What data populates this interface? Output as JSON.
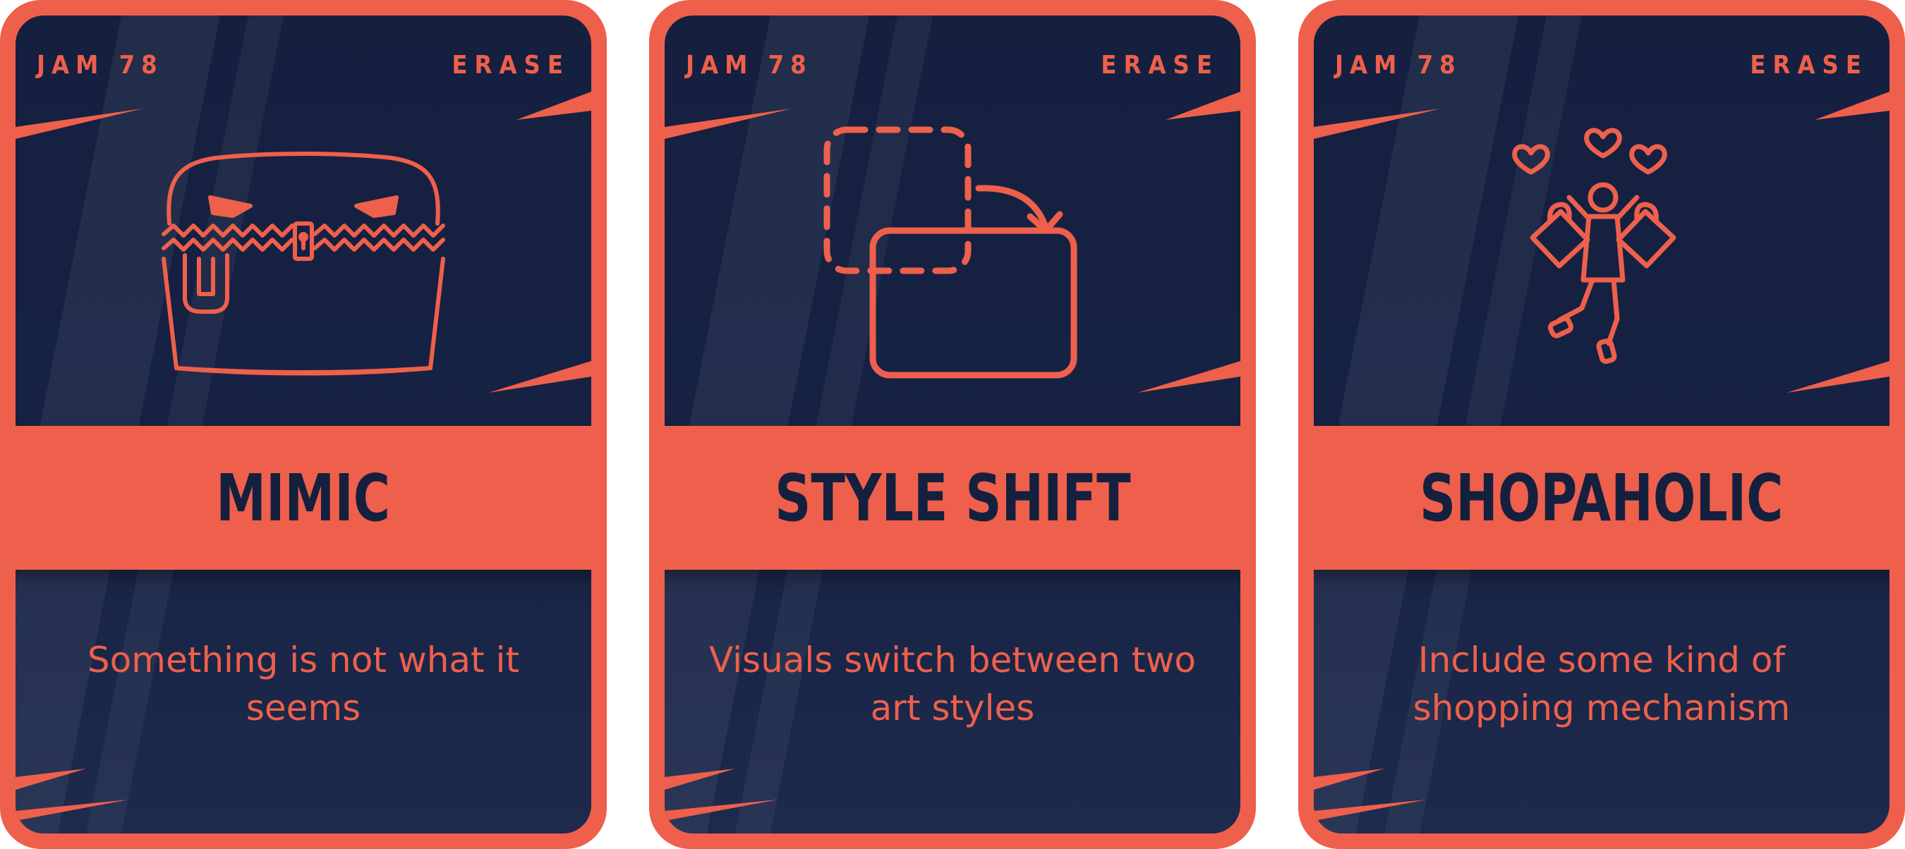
{
  "theme": {
    "accent": "#ee604b",
    "card_background": "#15203f",
    "title_color": "#15203f"
  },
  "cards": [
    {
      "jam": "JAM 78",
      "tag": "ERASE",
      "icon": "mimic-chest-icon",
      "title": "MIMIC",
      "description": "Something is not what it seems"
    },
    {
      "jam": "JAM 78",
      "tag": "ERASE",
      "icon": "style-shift-icon",
      "title": "STYLE SHIFT",
      "description": "Visuals switch between two art styles"
    },
    {
      "jam": "JAM 78",
      "tag": "ERASE",
      "icon": "shopaholic-icon",
      "title": "SHOPAHOLIC",
      "description": "Include some kind of shopping mechanism"
    }
  ]
}
